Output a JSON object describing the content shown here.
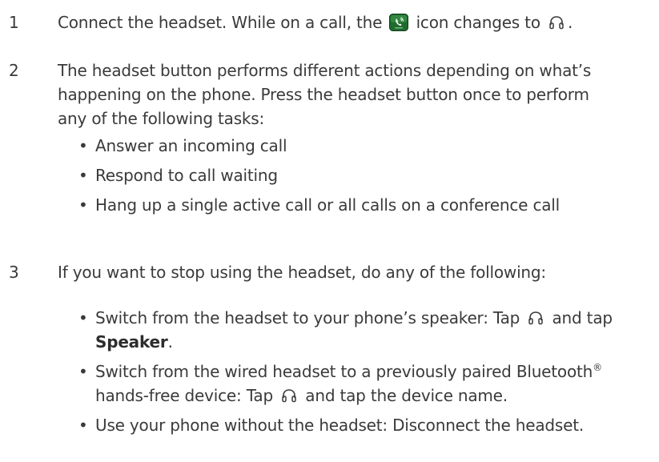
{
  "steps": [
    {
      "number": "1",
      "text_before_icon": "Connect the headset. While on a call, the ",
      "text_middle": " icon changes to ",
      "text_after": ".",
      "icons": [
        "phone-call-icon",
        "headset-icon"
      ]
    },
    {
      "number": "2",
      "text": "The headset button performs different actions depending on what’s happening on the phone. Press the headset button once to perform any of the following tasks:",
      "bullets": [
        "Answer an incoming call",
        "Respond to call waiting",
        "Hang up a single active call or all calls on a conference call"
      ]
    },
    {
      "number": "3",
      "text": "If you want to stop using the headset, do any of the following:",
      "bullets": [
        {
          "before": "Switch from the headset to your phone’s speaker: Tap ",
          "middle": " and tap ",
          "bold": "Speaker",
          "after": "."
        },
        {
          "before": "Switch from the wired headset to a previously paired Bluetooth",
          "sup": "®",
          "middle": " hands-free device: Tap ",
          "after": " and tap the device name."
        },
        {
          "text": "Use your phone without the headset: Disconnect the headset."
        }
      ]
    }
  ],
  "bullet_char": "•",
  "colors": {
    "text": "#3a3a3a",
    "phone_icon_bg": "#1f6b2e",
    "headset_icon": "#3a3a3a"
  }
}
